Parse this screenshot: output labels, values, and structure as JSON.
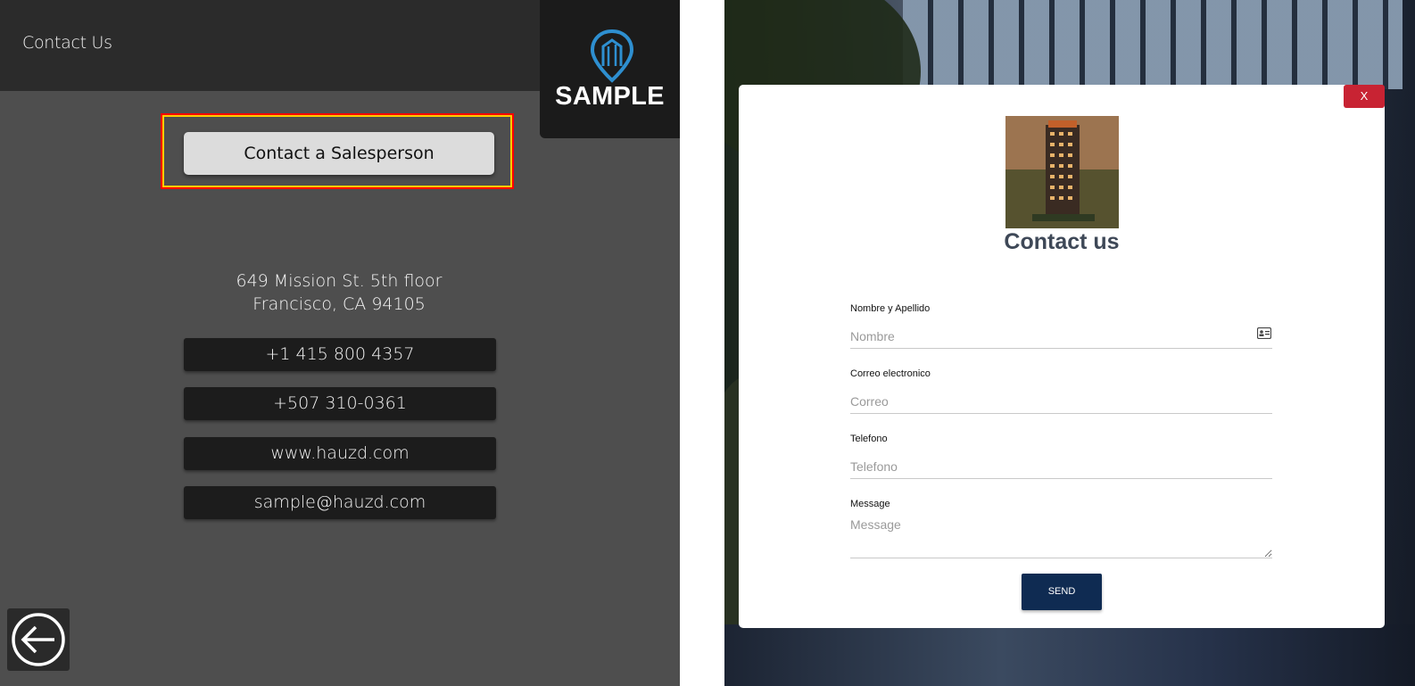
{
  "left_panel": {
    "header_title": "Contact Us",
    "logo_text": "SAMPLE",
    "contact_button_label": "Contact a Salesperson",
    "address_line1": "649 Mission St. 5th floor",
    "address_line2": "Francisco, CA 94105",
    "info_items": [
      {
        "label": "+1 415 800 4357"
      },
      {
        "label": "+507 310-0361"
      },
      {
        "label": "www.hauzd.com"
      },
      {
        "label": "sample@hauzd.com"
      }
    ],
    "back_icon": "arrow-left-circle-icon"
  },
  "modal": {
    "close_label": "X",
    "title": "Contact us",
    "fields": [
      {
        "label": "Nombre y Apellido",
        "placeholder": "Nombre",
        "value": ""
      },
      {
        "label": "Correo electronico",
        "placeholder": "Correo",
        "value": ""
      },
      {
        "label": "Telefono",
        "placeholder": "Telefono",
        "value": ""
      },
      {
        "label": "Message",
        "placeholder": "Message",
        "value": ""
      }
    ],
    "send_label": "SEND"
  },
  "colors": {
    "accent_logo": "#2e8fd0",
    "send_button": "#0f2b52",
    "close_button": "#c82333",
    "highlight_outer": "#ff0000",
    "highlight_inner": "#ffcc00"
  }
}
